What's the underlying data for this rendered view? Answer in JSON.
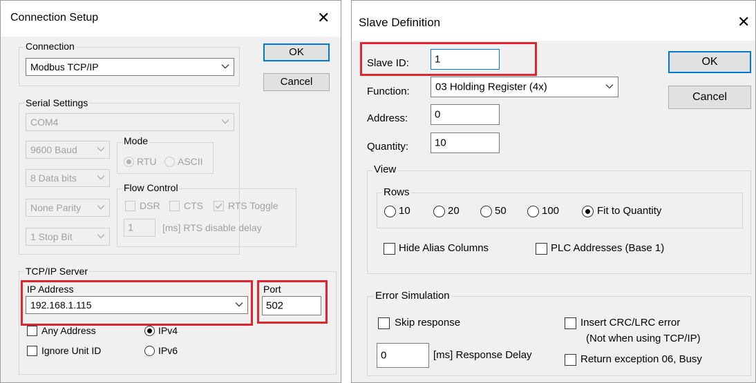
{
  "connection_setup": {
    "title": "Connection Setup",
    "connection_group_label": "Connection",
    "connection_value": "Modbus TCP/IP",
    "ok_label": "OK",
    "cancel_label": "Cancel",
    "serial": {
      "group_label": "Serial Settings",
      "port_value": "COM4",
      "baud_value": "9600 Baud",
      "data_bits_value": "8 Data bits",
      "parity_value": "None Parity",
      "stop_bit_value": "1 Stop Bit",
      "mode_label": "Mode",
      "mode_rtu": "RTU",
      "mode_ascii": "ASCII",
      "flow_label": "Flow Control",
      "dsr_label": "DSR",
      "cts_label": "CTS",
      "rts_toggle_label": "RTS Toggle",
      "rts_delay_value": "1",
      "rts_delay_label": "[ms] RTS disable delay"
    },
    "tcp": {
      "group_label": "TCP/IP Server",
      "ip_label": "IP Address",
      "ip_value": "192.168.1.115",
      "port_label": "Port",
      "port_value": "502",
      "any_address_label": "Any Address",
      "ignore_unit_label": "Ignore Unit ID",
      "ipv4_label": "IPv4",
      "ipv6_label": "IPv6"
    }
  },
  "slave_definition": {
    "title": "Slave Definition",
    "slave_id_label": "Slave ID:",
    "slave_id_value": "1",
    "function_label": "Function:",
    "function_value": "03 Holding Register (4x)",
    "address_label": "Address:",
    "address_value": "0",
    "quantity_label": "Quantity:",
    "quantity_value": "10",
    "ok_label": "OK",
    "cancel_label": "Cancel",
    "view": {
      "group_label": "View",
      "rows_label": "Rows",
      "row_options": [
        "10",
        "20",
        "50",
        "100",
        "Fit to Quantity"
      ],
      "hide_alias_label": "Hide Alias Columns",
      "plc_addresses_label": "PLC Addresses (Base 1)"
    },
    "error": {
      "group_label": "Error Simulation",
      "skip_response_label": "Skip response",
      "delay_value": "0",
      "delay_label": "[ms] Response Delay",
      "insert_crc_label": "Insert CRC/LRC error",
      "insert_crc_note": "(Not when using TCP/IP)",
      "return_exception_label": "Return exception 06, Busy"
    }
  },
  "colors": {
    "highlight": "#e0252f",
    "default_button_border": "#0078d7",
    "dialog_bg": "#f0f0f0"
  }
}
